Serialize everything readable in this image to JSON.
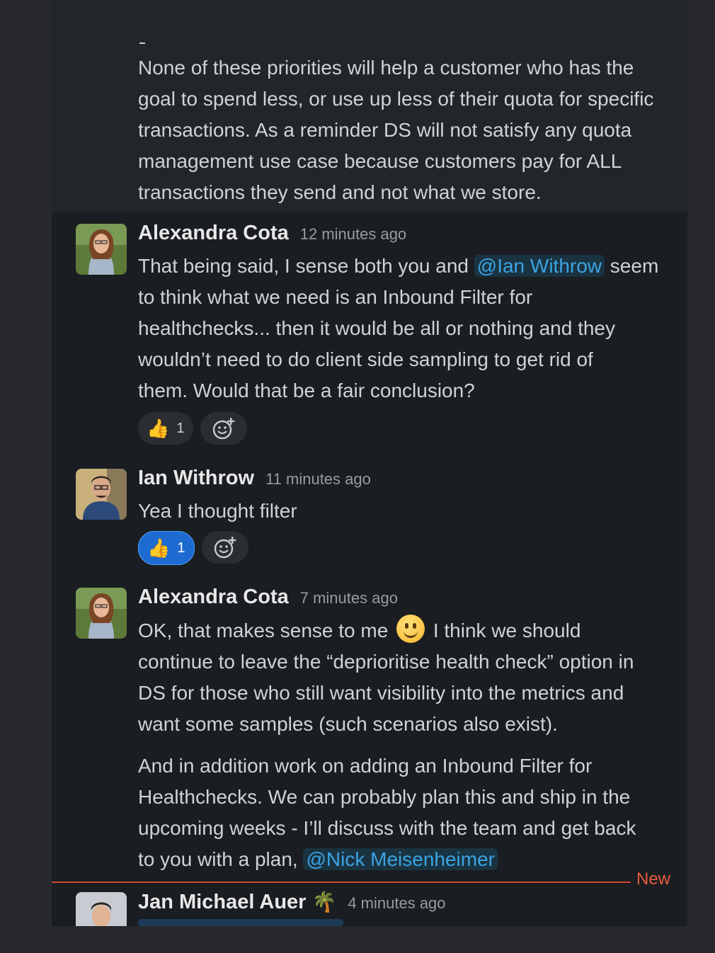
{
  "previous_message": {
    "lines": [
      "None of these priorities will help a customer who has the",
      "goal to spend less, or use up less of their quota for specific",
      "transactions. As a reminder DS will not satisfy any quota",
      "management use case because customers pay for ALL",
      "transactions they send and not what we store."
    ]
  },
  "messages": [
    {
      "author": "Alexandra Cota",
      "time": "12 minutes ago",
      "line1_pre": "That being said, I sense both you and ",
      "line1_mention": "@Ian Withrow",
      "line1_post": " seem",
      "lines": [
        "to think what we need is an Inbound Filter for",
        "healthchecks... then it would be all or nothing and they",
        "wouldn’t need to do client side sampling to get rid of",
        "them. Would that be a fair conclusion?"
      ],
      "reaction_count": "1"
    },
    {
      "author": "Ian Withrow",
      "time": "11 minutes ago",
      "text": "Yea I thought filter",
      "reaction_count": "1"
    },
    {
      "author": "Alexandra Cota",
      "time": "7 minutes ago",
      "line1_pre": "OK, that makes sense to me ",
      "line1_post": " I think we should",
      "lines": [
        "continue to leave the “deprioritise health check” option in",
        "DS for those who still want visibility into the metrics and",
        "want some samples (such scenarios also exist)."
      ],
      "para2": [
        "And in addition work on adding an Inbound Filter for",
        "Healthchecks. We can probably plan this and ship in the",
        "upcoming weeks - I’ll discuss with the team and get back"
      ],
      "last_pre": "to you with a plan, ",
      "last_mention": "@Nick Meisenheimer"
    },
    {
      "author": "Jan Michael Auer",
      "status_emoji": "🌴",
      "time": "4 minutes ago"
    }
  ],
  "new_divider_label": "New",
  "icons": {
    "reaction": "thumbs-up-icon",
    "add_reaction": "add-reaction-icon",
    "smile": "slightly-smiling-face-icon"
  },
  "colors": {
    "mention": "#3aa3e3",
    "new_divider": "#d1472f",
    "active_reaction": "#1d6bd0"
  }
}
